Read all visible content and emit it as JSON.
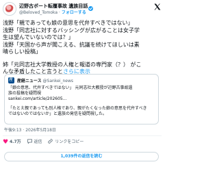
{
  "author": {
    "display_name": "辺野古ボート転覆事故 遺族目話",
    "handle": "@Beloved_Tomoka",
    "separator": "·",
    "follow_label": "フォローする"
  },
  "tweet": {
    "lines": [
      "浅野「親であっても娘の意思を代弁すべきではない」",
      "浅野「同志社に対するバッシングが広がることは女子学",
      "生は望んでいないのでは？」",
      "浅野「天国から声が聞こえる、抗議を続けてほしいは素",
      "晴らしい投稿」"
    ],
    "lines2": [
      "姉「元同志社大学教授の人権と報道の専門家（？） がこ",
      "んな矛盾したこと言うと"
    ],
    "show_more": "さらに表示"
  },
  "quoted": {
    "name": "産経ニュース",
    "handle": "@Sankei_news",
    "text_lines": [
      "「娘の意思、代弁すべきではない」 元同志社大教授が辺野古事故遺",
      "族の投稿を疑問視",
      "sankei.com/article/202605..."
    ],
    "text_lines2": [
      "「たとえ親であっても別人格であり、親がたくなった娘の意思を代弁すべき",
      "ではないのではないか」と遺族の発信を疑問視した。"
    ]
  },
  "meta": {
    "time": "午後9:13 · 2026年5月18日"
  },
  "actions": {
    "likes": "4.7万",
    "reply_label": "返信",
    "copy_link_label": "リンクをコピー"
  },
  "replies_button": "1,039件の返信を読む"
}
